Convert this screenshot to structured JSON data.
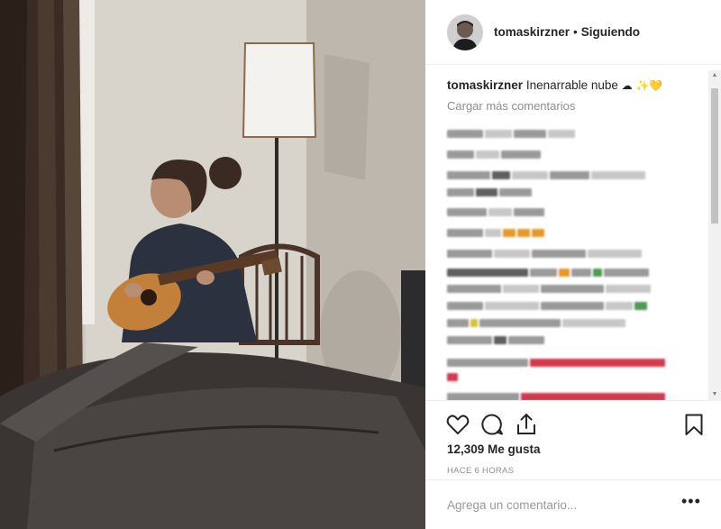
{
  "post": {
    "username": "tomaskirzner",
    "separator": "•",
    "follow_status": "Siguiendo",
    "caption_user": "tomaskirzner",
    "caption_text": "Inenarrable nube",
    "caption_emojis": "☁ ✨💛",
    "load_more": "Cargar más comentarios",
    "likes": "12,309 Me gusta",
    "time_ago": "HACE 6 HORAS",
    "comment_placeholder": "Agrega un comentario...",
    "more_options": "•••"
  },
  "icons": {
    "like": "heart-icon",
    "comment": "comment-bubble-icon",
    "share": "share-icon",
    "save": "bookmark-icon",
    "avatar": "profile-photo",
    "photo": "girl-playing-guitar-photo"
  },
  "colors": {
    "text": "#262626",
    "muted": "#8e8e8e",
    "border": "#efefef"
  }
}
